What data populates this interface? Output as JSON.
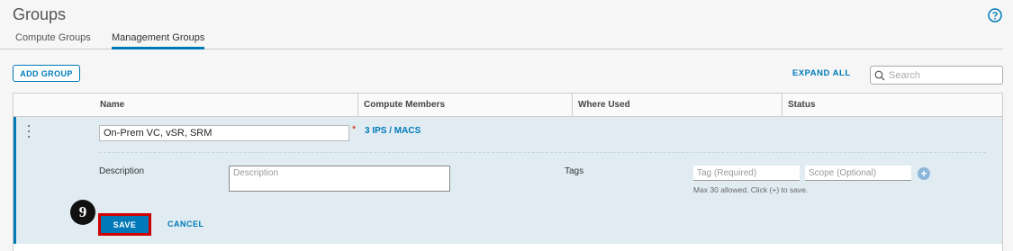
{
  "page": {
    "title": "Groups",
    "help_icon": "help-circle-icon"
  },
  "tabs": [
    {
      "label": "Compute Groups",
      "active": false
    },
    {
      "label": "Management Groups",
      "active": true
    }
  ],
  "toolbar": {
    "add_group_label": "ADD GROUP",
    "expand_all_label": "EXPAND ALL",
    "search_placeholder": "Search",
    "search_icon": "search-icon"
  },
  "grid": {
    "columns": [
      "Name",
      "Compute Members",
      "Where Used",
      "Status"
    ],
    "row": {
      "name_value": "On-Prem VC, vSR, SRM",
      "required_mark": "*",
      "members_link": "3 IPS / MACS",
      "description_label": "Description",
      "description_placeholder": "Description",
      "tags_label": "Tags",
      "tag_placeholder": "Tag (Required)",
      "scope_placeholder": "Scope (Optional)",
      "add_tag_symbol": "+",
      "tags_hint": "Max 30 allowed. Click (+) to save.",
      "save_label": "SAVE",
      "cancel_label": "CANCEL"
    }
  },
  "annotation": {
    "step_number": "9"
  },
  "colors": {
    "accent": "#0079b8",
    "highlight": "#d00000",
    "row_bg": "#e0ecf2"
  }
}
